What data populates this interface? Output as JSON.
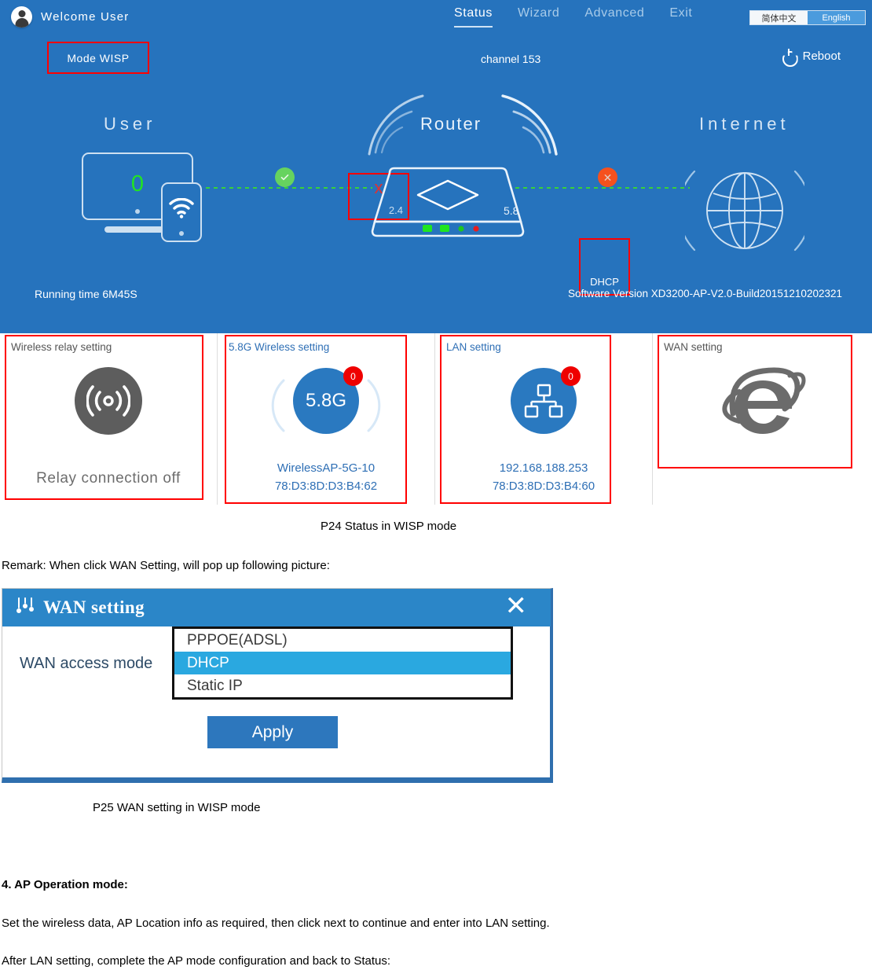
{
  "router_ui": {
    "navbar": {
      "welcome": "Welcome User",
      "avatar_icon": "user-avatar-icon",
      "links": [
        {
          "label": "Status",
          "active": true
        },
        {
          "label": "Wizard",
          "active": false
        },
        {
          "label": "Advanced",
          "active": false
        },
        {
          "label": "Exit",
          "active": false
        }
      ],
      "language": {
        "chinese": "简体中文",
        "english": "English",
        "selected": "English"
      }
    },
    "statusbar": {
      "mode": "Mode  WISP",
      "channel": "channel 153",
      "reboot": "Reboot",
      "reboot_icon": "power-icon"
    },
    "topology": {
      "user_label": "User",
      "router_label": "Router",
      "internet_label": "Internet",
      "client_count": "0",
      "band_24": "2.4",
      "band_24_status": "x",
      "band_58": "5.8",
      "link_left_status": "ok",
      "link_right_status": "fail",
      "dhcp_label": "DHCP"
    },
    "footer": {
      "running_time": "Running time  6M45S",
      "software_version": "Software Version  XD3200-AP-V2.0-Build20151210202321"
    },
    "cards": [
      {
        "title": "Wireless relay setting",
        "icon": "relay-broadcast-icon",
        "status_text": "Relay connection off",
        "lines": []
      },
      {
        "title": "5.8G Wireless setting",
        "icon": "wifi-5g-circle-icon",
        "badge": "0",
        "circle_label": "5.8G",
        "lines": [
          "WirelessAP-5G-10",
          "78:D3:8D:D3:B4:62"
        ]
      },
      {
        "title": "LAN setting",
        "icon": "network-tree-icon",
        "badge": "0",
        "lines": [
          "192.168.188.253",
          "78:D3:8D:D3:B4:60"
        ]
      },
      {
        "title": "WAN setting",
        "icon": "internet-explorer-icon",
        "lines": []
      }
    ],
    "colors": {
      "panel_blue": "#2673bd",
      "highlight_red": "#ff0000",
      "accent_blue": "#2a79c0",
      "ok_green": "#66d35f",
      "fail_orange": "#f5511e",
      "badge_red": "#ef0000"
    }
  },
  "wan_dialog": {
    "title": "WAN setting",
    "title_icon": "sliders-icon",
    "close_icon": "close-icon",
    "field_label": "WAN access mode",
    "options": [
      "PPPOE(ADSL)",
      "DHCP",
      "Static IP"
    ],
    "selected_option": "DHCP",
    "apply_label": "Apply"
  },
  "document": {
    "caption_p24": "P24 Status in WISP mode",
    "remark": "Remark: When click WAN Setting, will pop up following picture:",
    "caption_p25": "P25 WAN setting in WISP mode",
    "section_heading": "4. AP Operation mode:",
    "paragraph_1": "Set the wireless data, AP Location info as required, then click next to continue and enter into LAN setting.",
    "paragraph_2": "After LAN setting, complete the AP mode configuration and back to Status:"
  }
}
